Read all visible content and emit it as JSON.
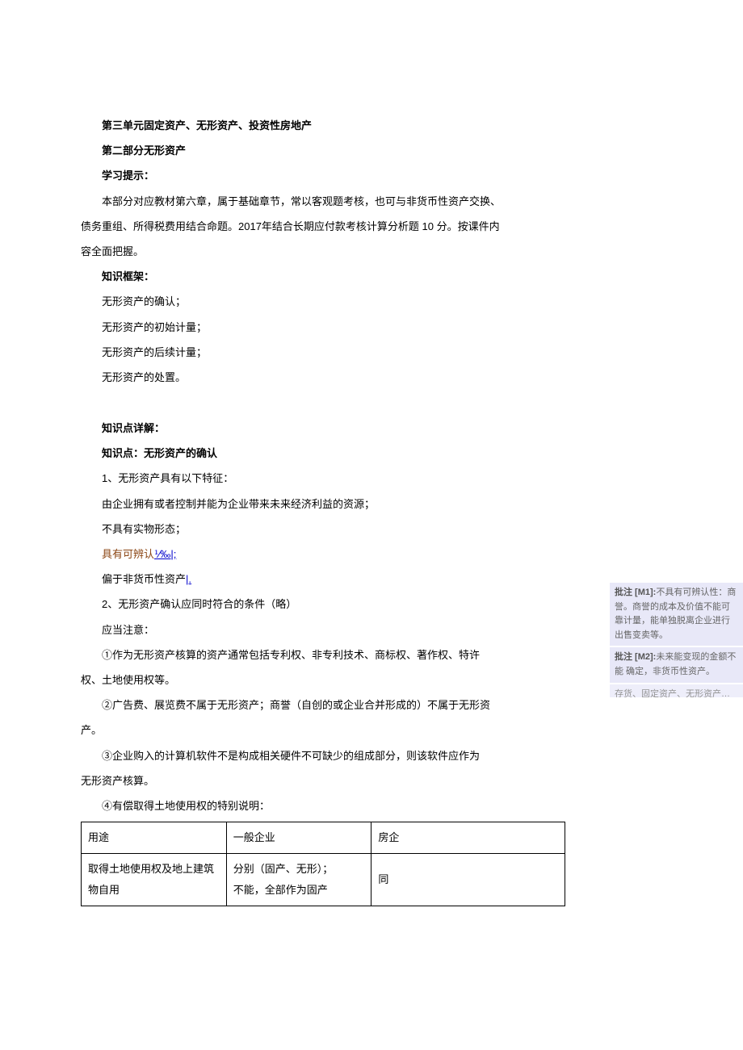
{
  "title_unit": "第三单元固定资产、无形资产、投资性房地产",
  "title_part": "第二部分无形资产",
  "study_label": "学习提示：",
  "study_text": "本部分对应教材第六章，属于基础章节，常以客观题考核，也可与非货币性资产交换、债务重组、所得税费用结合命题。2017年结合长期应付款考核计算分析题 10 分。按课件内容全面把握。",
  "framework_label": "知识框架：",
  "framework": {
    "i0": "无形资产的确认；",
    "i1": "无形资产的初始计量；",
    "i2": "无形资产的后续计量；",
    "i3": "无形资产的处置。"
  },
  "detail_label": "知识点详解：",
  "kp_title": "知识点：无形资产的确认",
  "kp1": "1、无形资产具有以下特征：",
  "kp1a": "由企业拥有或者控制并能为企业带来未来经济利益的资源；",
  "kp1b": "不具有实物形态；",
  "kp1c_pre": "具有可辨认",
  "kp1c_link": "⅟‰|;",
  "kp1d_pre": "偏于非货币性资产",
  "kp1d_link": "|.",
  "kp2": "2、无形资产确认应同时符合的条件（略）",
  "note_label": "应当注意：",
  "note1a": "①作为无形资产核算的资产通常包括专利权、非专利技术、商标权、著作权、特许",
  "note1b": "权、土地使用权等。",
  "note2": "②广告费、展览费不属于无形资产；商誉（自创的或企业合并形成的）不属于无形资产。",
  "note3a": "③企业购入的计算机软件不是构成相关硬件不可缺少的组成部分，则该软件应作为",
  "note3b": "无形资产核算。",
  "note4": "④有偿取得土地使用权的特别说明：",
  "table": {
    "h1": "用途",
    "h2": "一般企业",
    "h3": "房企",
    "r1c1": "取得土地使用权及地上建筑物自用",
    "r1c2a": "分别（固产、无形）；",
    "r1c2b": "不能，全部作为固产",
    "r1c3": "同"
  },
  "comments": {
    "m1": {
      "tag": "批注 [M1]:",
      "text": "不具有可辨认性：商誉。商誉的成本及价值不能可靠计量，能单独脱离企业进行出售变卖等。"
    },
    "m2": {
      "tag": "批注 [M2]:",
      "text": "未来能变现的金额不能  确定，非货币性资产。"
    },
    "m2b": "存货、固定资产、无形资产…"
  }
}
